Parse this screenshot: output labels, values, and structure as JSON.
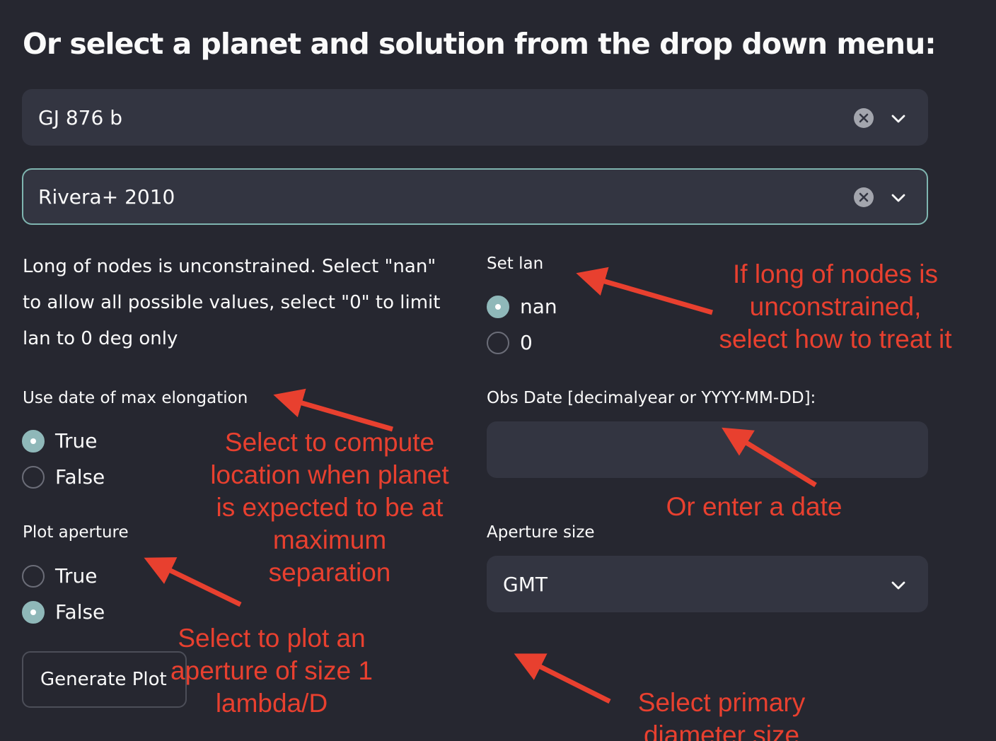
{
  "heading": "Or select a planet and solution from the drop down menu:",
  "planet_select": {
    "value": "GJ 876 b"
  },
  "solution_select": {
    "value": "Rivera+ 2010"
  },
  "lan_description": "Long of nodes is unconstrained. Select \"nan\" to allow all possible values, select \"0\" to limit lan to 0 deg only",
  "set_lan": {
    "label": "Set lan",
    "options": [
      {
        "label": "nan",
        "checked": true
      },
      {
        "label": "0",
        "checked": false
      }
    ]
  },
  "max_elongation": {
    "label": "Use date of max elongation",
    "options": [
      {
        "label": "True",
        "checked": true
      },
      {
        "label": "False",
        "checked": false
      }
    ]
  },
  "obs_date": {
    "label": "Obs Date [decimalyear or YYYY-MM-DD]:",
    "value": ""
  },
  "plot_aperture": {
    "label": "Plot aperture",
    "options": [
      {
        "label": "True",
        "checked": false
      },
      {
        "label": "False",
        "checked": true
      }
    ]
  },
  "aperture_size": {
    "label": "Aperture size",
    "value": "GMT"
  },
  "generate_button": {
    "label": "Generate Plot"
  },
  "annotations": {
    "lan": [
      "If long of nodes is",
      "unconstrained,",
      "select how to treat it"
    ],
    "max_elong": [
      "Select to compute",
      "location when planet",
      "is expected to be at",
      "maximum",
      "separation"
    ],
    "date": [
      "Or enter a date"
    ],
    "aperture": [
      "Select to plot an",
      "aperture of size 1",
      "lambda/D"
    ],
    "diameter": [
      "Select primary",
      "diameter size"
    ]
  },
  "colors": {
    "background": "#262730",
    "input_bg": "#333541",
    "accent": "#8fb8b9",
    "focus_border": "#7fb5b0",
    "annotation": "#e8402f"
  }
}
